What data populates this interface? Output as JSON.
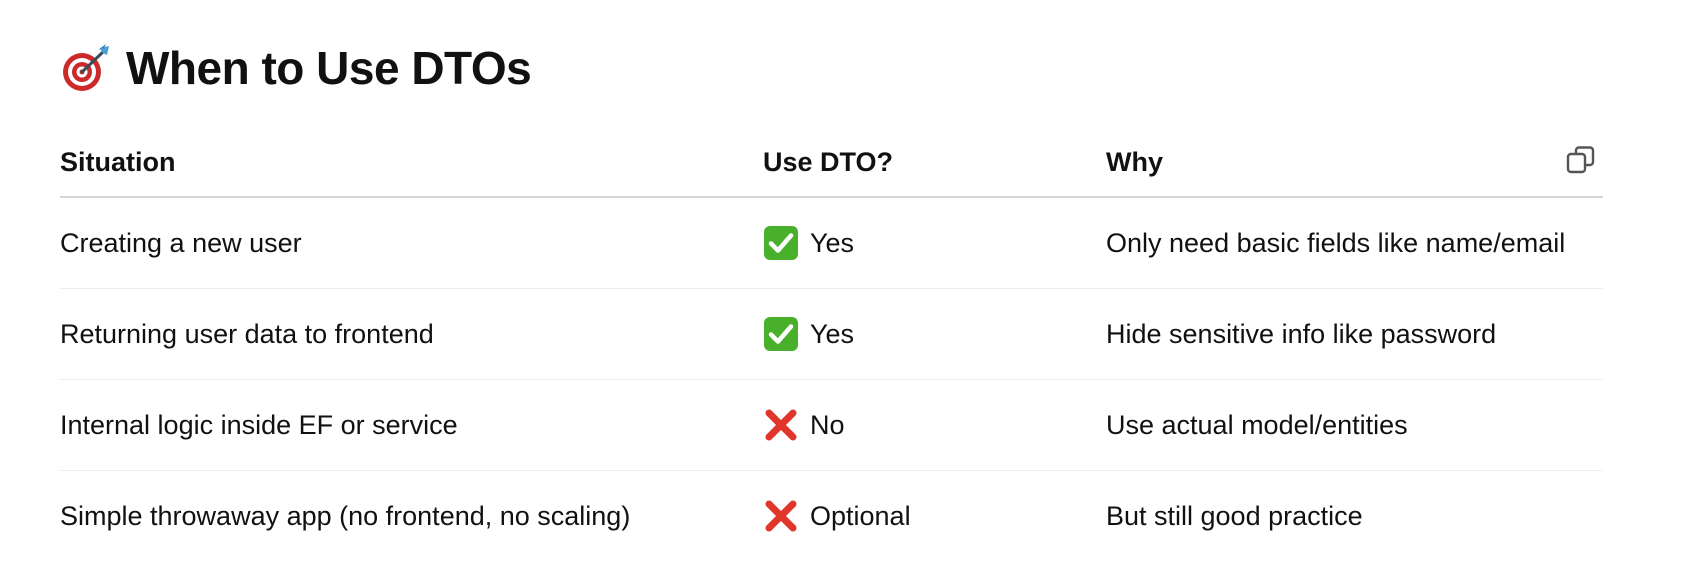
{
  "heading": {
    "icon": "dart-target-icon",
    "title": "When to Use DTOs"
  },
  "table": {
    "headers": [
      "Situation",
      "Use DTO?",
      "Why"
    ],
    "copy_icon": "copy-icon",
    "rows": [
      {
        "situation": "Creating a new user",
        "use_dto_icon": "check-mark-icon",
        "use_dto": "Yes",
        "why": "Only need basic fields like name/email"
      },
      {
        "situation": "Returning user data to frontend",
        "use_dto_icon": "check-mark-icon",
        "use_dto": "Yes",
        "why": "Hide sensitive info like password"
      },
      {
        "situation": "Internal logic inside EF or service",
        "use_dto_icon": "cross-mark-icon",
        "use_dto": "No",
        "why": "Use actual model/entities"
      },
      {
        "situation": "Simple throwaway app (no frontend, no scaling)",
        "use_dto_icon": "cross-mark-icon",
        "use_dto": "Optional",
        "why": "But still good practice"
      }
    ]
  },
  "colors": {
    "check_green": "#48b02a",
    "cross_red": "#e0362b",
    "target_red": "#cc2a2a",
    "dart_blue": "#4a9fd8",
    "text": "#111111",
    "header_border": "#d4d4d4",
    "row_border": "#ececec"
  }
}
